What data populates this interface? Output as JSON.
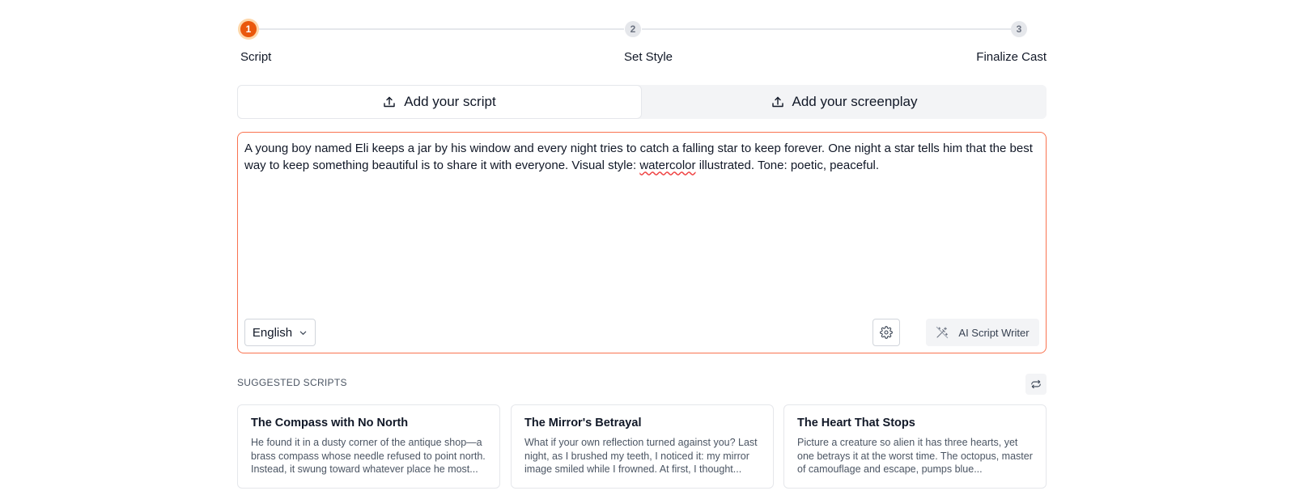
{
  "stepper": {
    "steps": [
      {
        "number": "1",
        "label": "Script",
        "state": "active"
      },
      {
        "number": "2",
        "label": "Set Style",
        "state": "idle"
      },
      {
        "number": "3",
        "label": "Finalize Cast",
        "state": "idle"
      }
    ]
  },
  "tabs": [
    {
      "label": "Add your script",
      "icon": "upload-icon",
      "selected": true
    },
    {
      "label": "Add your screenplay",
      "icon": "upload-icon",
      "selected": false
    }
  ],
  "editor": {
    "text_before": "A young boy named Eli keeps a jar by his window and every night tries to catch a falling star to keep forever. One night a star tells him that the best way to keep something beautiful is to share it with everyone. Visual style: ",
    "misspelled_word": "watercolor",
    "text_after": " illustrated. Tone: poetic, peaceful.",
    "language": "English",
    "ai_button_label": "AI Script Writer"
  },
  "suggested": {
    "heading": "SUGGESTED SCRIPTS",
    "cards": [
      {
        "title": "The Compass with No North",
        "description": "He found it in a dusty corner of the antique shop—a brass compass whose needle refused to point north. Instead, it swung toward whatever place he most..."
      },
      {
        "title": "The Mirror's Betrayal",
        "description": "What if your own reflection turned against you? Last night, as I brushed my teeth, I noticed it: my mirror image smiled while I frowned. At first, I thought..."
      },
      {
        "title": "The Heart That Stops",
        "description": "Picture a creature so alien it has three hearts, yet one betrays it at the worst time. The octopus, master of camouflage and escape, pumps blue..."
      }
    ]
  },
  "colors": {
    "accent": "#ea580c",
    "editor_border": "#f97350"
  }
}
